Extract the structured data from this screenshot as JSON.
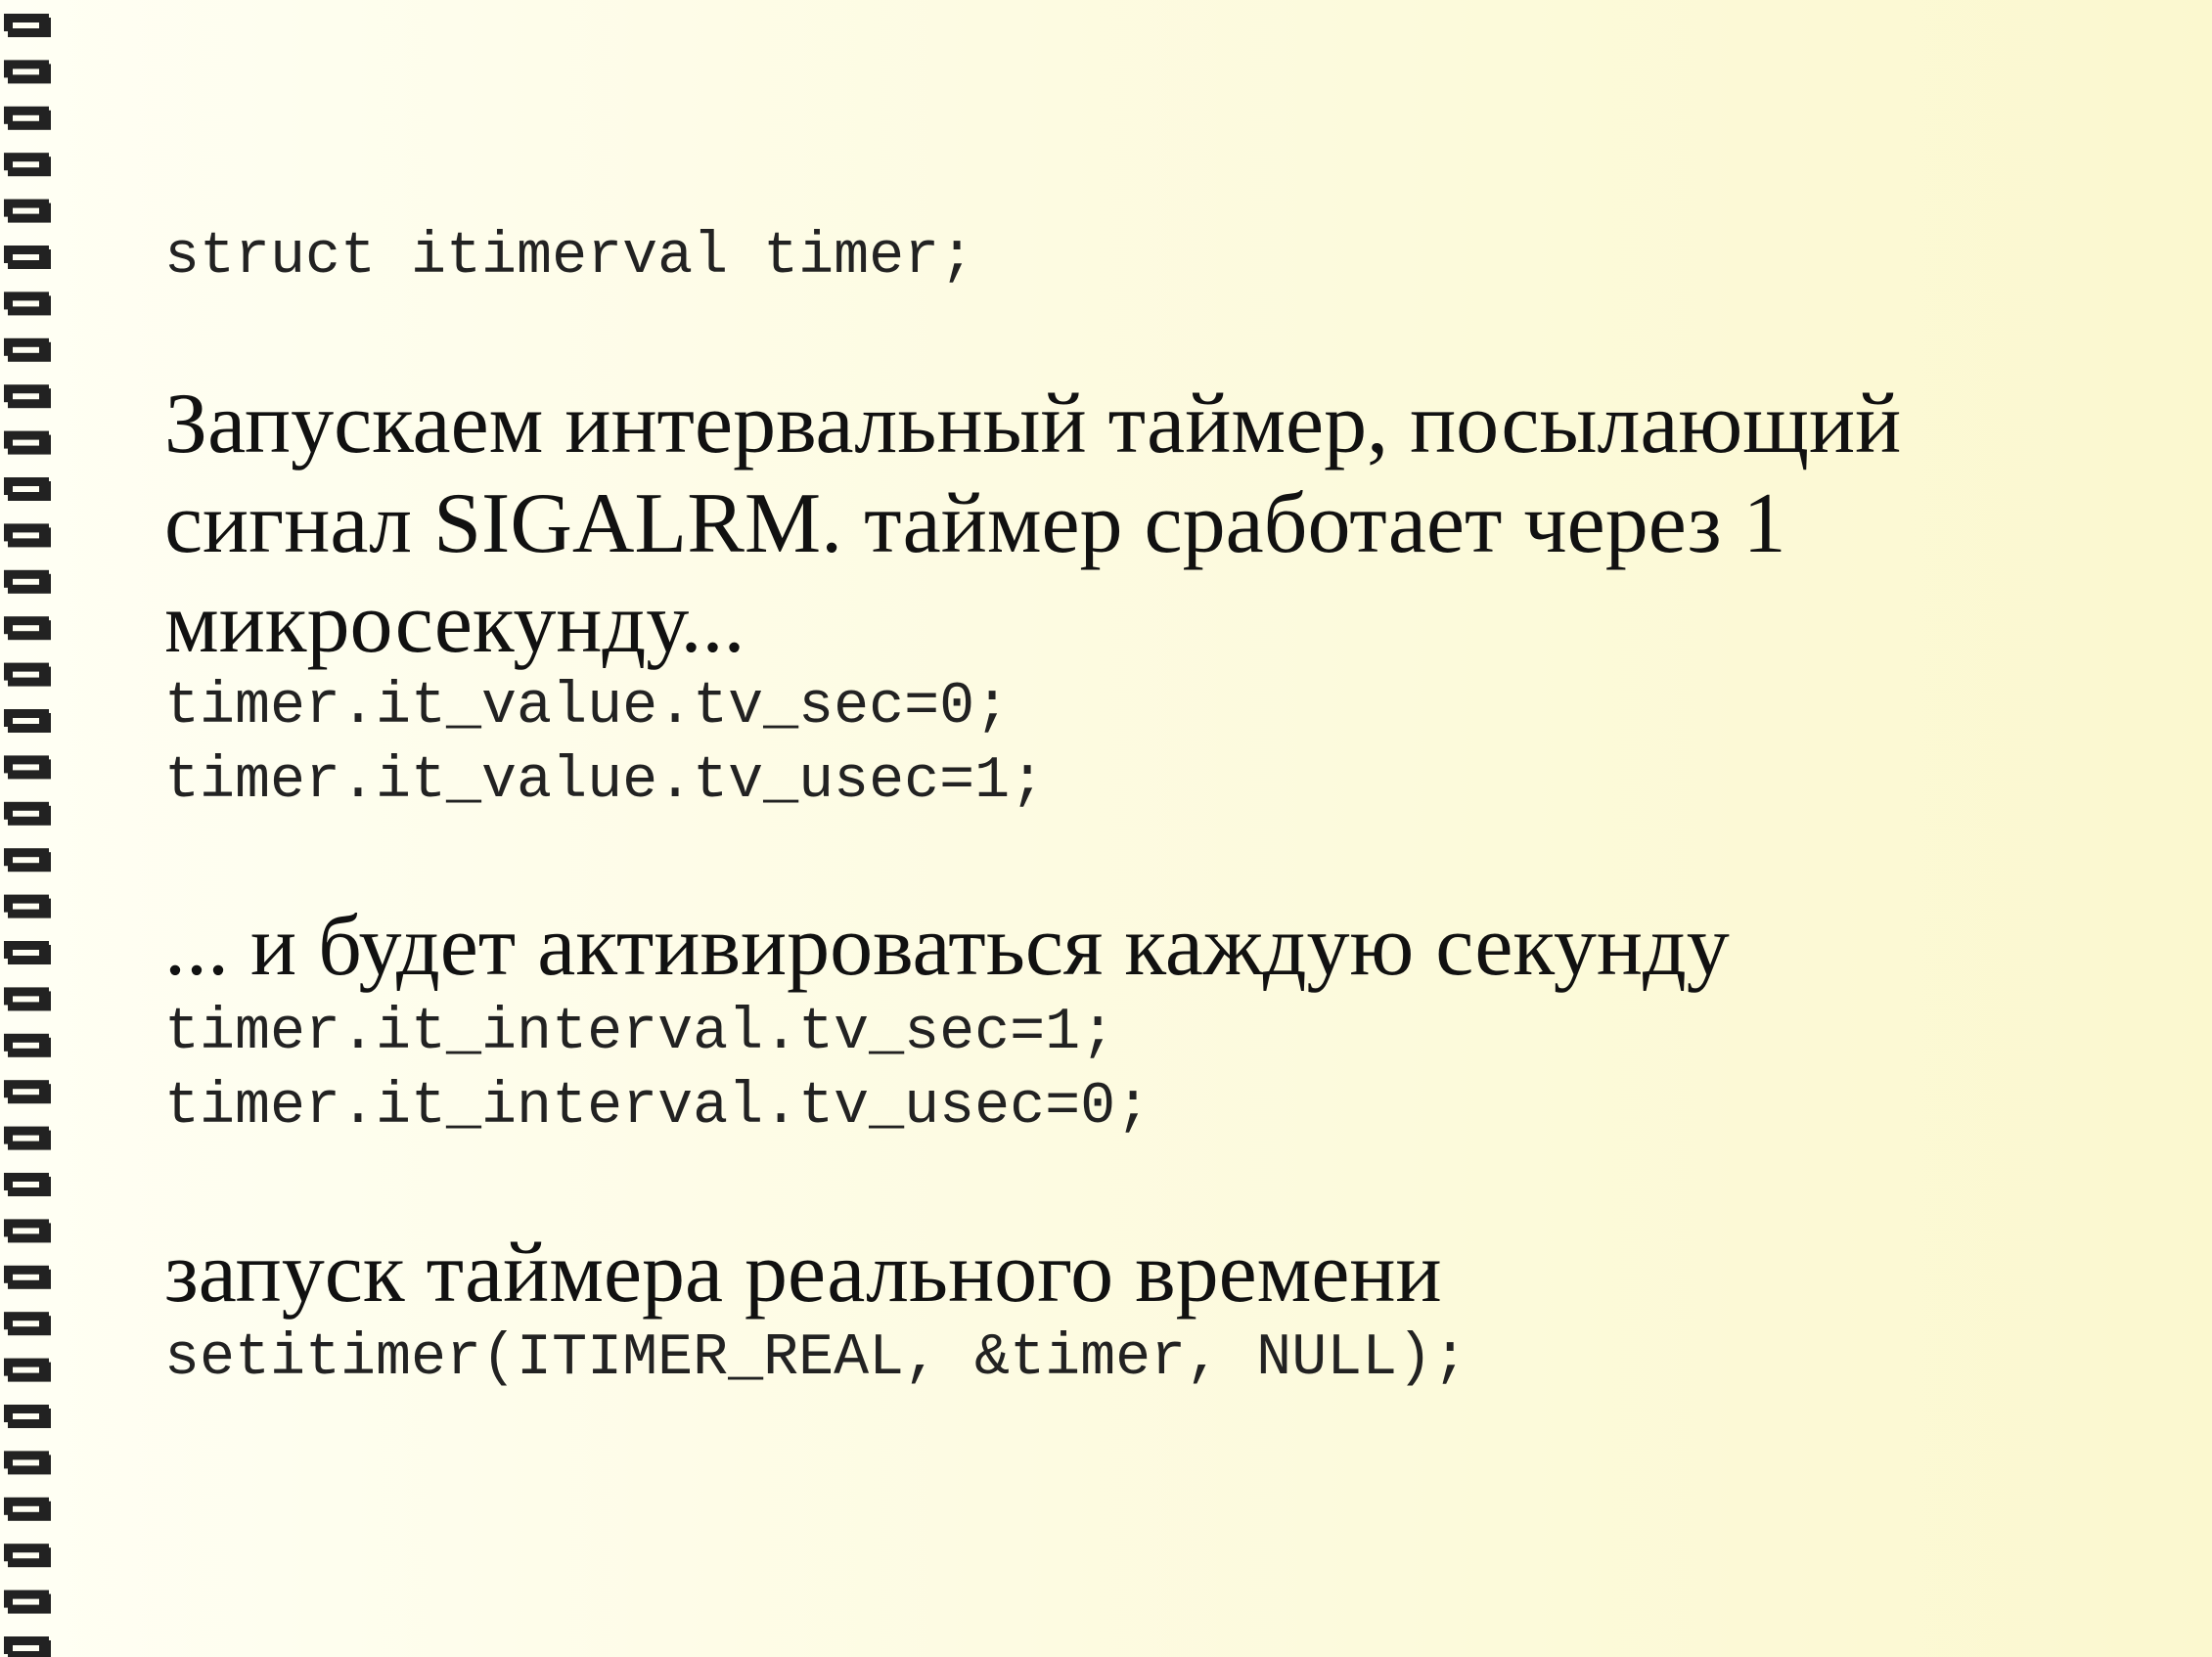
{
  "slide": {
    "declaration": "struct itimerval timer;",
    "note_start": [
      "Запускаем интервальный таймер, посылающий",
      "сигнал SIGALRM. таймер сработает через 1",
      "микросекунду..."
    ],
    "code_value": [
      "timer.it_value.tv_sec=0;",
      "timer.it_value.tv_usec=1;"
    ],
    "note_interval": "... и будет активироваться каждую секунду",
    "code_interval": [
      "timer.it_interval.tv_sec=1;",
      "timer.it_interval.tv_usec=0;"
    ],
    "note_launch": "запуск таймера реального времени",
    "code_launch": "setitimer(ITIMER_REAL, &timer, NULL);"
  },
  "theme": {
    "text_color": "#111111",
    "code_color": "#222222",
    "binding_color": "#222222"
  }
}
